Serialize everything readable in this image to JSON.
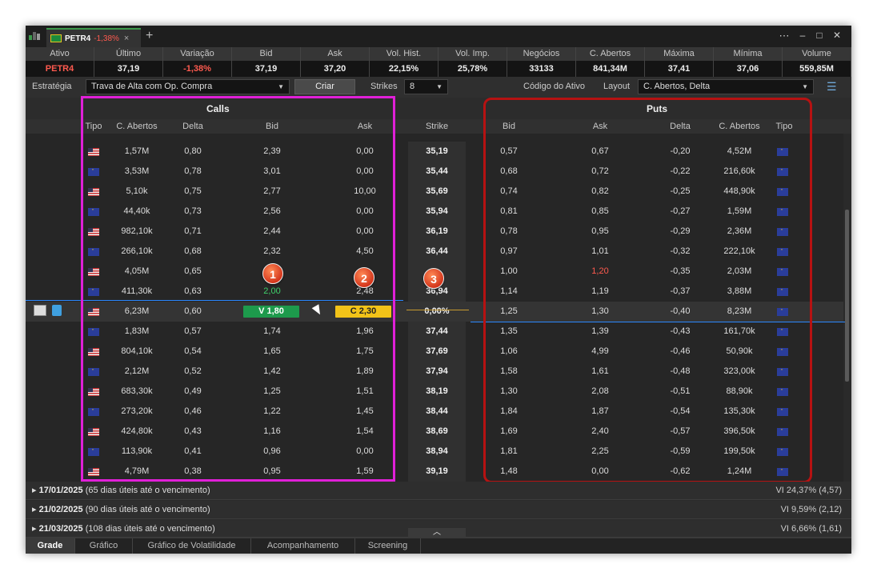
{
  "tab": {
    "ticker": "PETR4",
    "variation": "-1,38%",
    "close": "×",
    "new_tab": "+"
  },
  "window": {
    "menu_icon": "ellipsis-circle-icon",
    "minimize": "–",
    "maximize": "□",
    "close": "✕"
  },
  "quote_header": {
    "labels": [
      "Ativo",
      "Último",
      "Variação",
      "Bid",
      "Ask",
      "Vol. Hist.",
      "Vol. Imp.",
      "Negócios",
      "C. Abertos",
      "Máxima",
      "Mínima",
      "Volume"
    ],
    "values": [
      "PETR4",
      "37,19",
      "-1,38%",
      "37,19",
      "37,20",
      "22,15%",
      "25,78%",
      "33133",
      "841,34M",
      "37,41",
      "37,06",
      "559,85M"
    ]
  },
  "toolbar": {
    "strategy_label": "Estratégia",
    "strategy_value": "Trava de Alta com Op. Compra",
    "create_button": "Criar",
    "strikes_label": "Strikes",
    "strikes_value": "8",
    "asset_code_label": "Código do Ativo",
    "layout_label": "Layout",
    "layout_value": "C. Abertos, Delta",
    "settings_icon": "sliders-icon"
  },
  "sections": {
    "calls": "Calls",
    "puts": "Puts"
  },
  "columns": {
    "calls": [
      "Tipo",
      "C. Abertos",
      "Delta",
      "Bid",
      "Ask"
    ],
    "strike": "Strike",
    "puts": [
      "Bid",
      "Ask",
      "Delta",
      "C. Abertos",
      "Tipo"
    ]
  },
  "rows": [
    {
      "ct": "us",
      "coi": "1,57M",
      "cd": "0,80",
      "cb": "2,39",
      "ca": "0,00",
      "k": "35,19",
      "pb": "0,57",
      "pa": "0,67",
      "pd": "-0,20",
      "poi": "4,52M",
      "pt": "eu"
    },
    {
      "ct": "eu",
      "coi": "3,53M",
      "cd": "0,78",
      "cb": "3,01",
      "ca": "0,00",
      "k": "35,44",
      "pb": "0,68",
      "pa": "0,72",
      "pd": "-0,22",
      "poi": "216,60k",
      "pt": "eu"
    },
    {
      "ct": "us",
      "coi": "5,10k",
      "cd": "0,75",
      "cb": "2,77",
      "ca": "10,00",
      "k": "35,69",
      "pb": "0,74",
      "pa": "0,82",
      "pd": "-0,25",
      "poi": "448,90k",
      "pt": "eu"
    },
    {
      "ct": "eu",
      "coi": "44,40k",
      "cd": "0,73",
      "cb": "2,56",
      "ca": "0,00",
      "k": "35,94",
      "pb": "0,81",
      "pa": "0,85",
      "pd": "-0,27",
      "poi": "1,59M",
      "pt": "eu"
    },
    {
      "ct": "us",
      "coi": "982,10k",
      "cd": "0,71",
      "cb": "2,44",
      "ca": "0,00",
      "k": "36,19",
      "pb": "0,78",
      "pa": "0,95",
      "pd": "-0,29",
      "poi": "2,36M",
      "pt": "eu"
    },
    {
      "ct": "eu",
      "coi": "266,10k",
      "cd": "0,68",
      "cb": "2,32",
      "ca": "4,50",
      "k": "36,44",
      "pb": "0,97",
      "pa": "1,01",
      "pd": "-0,32",
      "poi": "222,10k",
      "pt": "eu"
    },
    {
      "ct": "us",
      "coi": "4,05M",
      "cd": "0,65",
      "cb": "",
      "ca": "",
      "k": "",
      "pb": "1,00",
      "pa": "1,20",
      "pd": "-0,35",
      "poi": "2,03M",
      "pt": "eu"
    },
    {
      "ct": "eu",
      "coi": "411,30k",
      "cd": "0,63",
      "cb": "2,00",
      "ca": "2,48",
      "k": "36,94",
      "pb": "1,14",
      "pa": "1,19",
      "pd": "-0,37",
      "poi": "3,88M",
      "pt": "eu"
    },
    {
      "ct": "us",
      "coi": "6,23M",
      "cd": "0,60",
      "cb": "V 1,80",
      "ca": "C 2,30",
      "k": "0,00%",
      "pb": "1,25",
      "pa": "1,30",
      "pd": "-0,40",
      "poi": "8,23M",
      "pt": "eu"
    },
    {
      "ct": "eu",
      "coi": "1,83M",
      "cd": "0,57",
      "cb": "1,74",
      "ca": "1,96",
      "k": "37,44",
      "pb": "1,35",
      "pa": "1,39",
      "pd": "-0,43",
      "poi": "161,70k",
      "pt": "eu"
    },
    {
      "ct": "us",
      "coi": "804,10k",
      "cd": "0,54",
      "cb": "1,65",
      "ca": "1,75",
      "k": "37,69",
      "pb": "1,06",
      "pa": "4,99",
      "pd": "-0,46",
      "poi": "50,90k",
      "pt": "eu"
    },
    {
      "ct": "eu",
      "coi": "2,12M",
      "cd": "0,52",
      "cb": "1,42",
      "ca": "1,89",
      "k": "37,94",
      "pb": "1,58",
      "pa": "1,61",
      "pd": "-0,48",
      "poi": "323,00k",
      "pt": "eu"
    },
    {
      "ct": "us",
      "coi": "683,30k",
      "cd": "0,49",
      "cb": "1,25",
      "ca": "1,51",
      "k": "38,19",
      "pb": "1,30",
      "pa": "2,08",
      "pd": "-0,51",
      "poi": "88,90k",
      "pt": "eu"
    },
    {
      "ct": "eu",
      "coi": "273,20k",
      "cd": "0,46",
      "cb": "1,22",
      "ca": "1,45",
      "k": "38,44",
      "pb": "1,84",
      "pa": "1,87",
      "pd": "-0,54",
      "poi": "135,30k",
      "pt": "eu"
    },
    {
      "ct": "us",
      "coi": "424,80k",
      "cd": "0,43",
      "cb": "1,16",
      "ca": "1,54",
      "k": "38,69",
      "pb": "1,69",
      "pa": "2,40",
      "pd": "-0,57",
      "poi": "396,50k",
      "pt": "eu"
    },
    {
      "ct": "eu",
      "coi": "113,90k",
      "cd": "0,41",
      "cb": "0,96",
      "ca": "0,00",
      "k": "38,94",
      "pb": "1,81",
      "pa": "2,25",
      "pd": "-0,59",
      "poi": "199,50k",
      "pt": "eu"
    },
    {
      "ct": "us",
      "coi": "4,79M",
      "cd": "0,38",
      "cb": "0,95",
      "ca": "1,59",
      "k": "39,19",
      "pb": "1,48",
      "pa": "0,00",
      "pd": "-0,62",
      "poi": "1,24M",
      "pt": "eu"
    }
  ],
  "badges": [
    "1",
    "2",
    "3"
  ],
  "expirations": [
    {
      "date": "17/01/2025",
      "desc": "(65 dias úteis até o vencimento)",
      "vi": "VI 24,37% (4,57)"
    },
    {
      "date": "21/02/2025",
      "desc": "(90 dias úteis até o vencimento)",
      "vi": "VI 9,59% (2,12)"
    },
    {
      "date": "21/03/2025",
      "desc": "(108 dias úteis até o vencimento)",
      "vi": "VI 6,66% (1,61)"
    }
  ],
  "bottom_tabs": [
    "Grade",
    "Gráfico",
    "Gráfico de Volatilidade",
    "Acompanhamento",
    "Screening"
  ],
  "colors": {
    "accent_green": "#1d9a4c",
    "accent_yellow": "#f2c318",
    "negative": "#ff5a4f",
    "calls_box": "#e020d8",
    "puts_box": "#b61212"
  }
}
